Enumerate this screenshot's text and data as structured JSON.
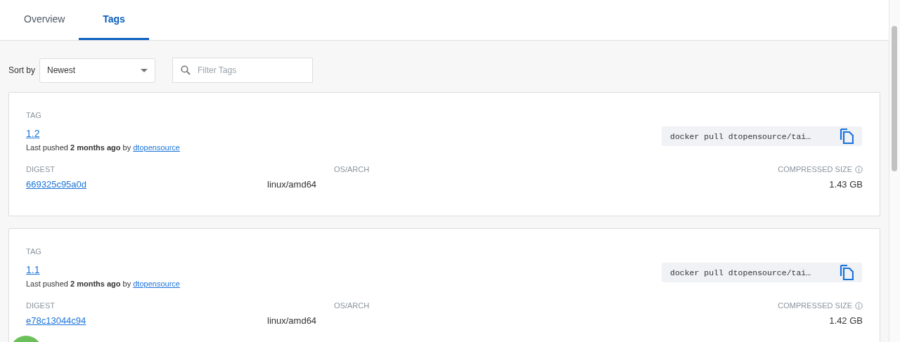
{
  "tabs": [
    {
      "label": "Overview",
      "selected": false
    },
    {
      "label": "Tags",
      "selected": true
    }
  ],
  "toolbar": {
    "sort_label": "Sort by",
    "sort_value": "Newest",
    "filter": {
      "placeholder": "Filter Tags"
    }
  },
  "tags": [
    {
      "tag_label": "TAG",
      "tag": "1.2",
      "pushed": "Last pushed **2 months ago** by",
      "user": "dtopensource",
      "command": "docker pull dtopensource/tai…",
      "digest_label": "DIGEST",
      "digest": "669325c95a0d",
      "os_label": "OS/ARCH",
      "os": "linux/amd64",
      "size_label": "COMPRESSED SIZE",
      "size": "1.43 GB"
    },
    {
      "tag_label": "TAG",
      "tag": "1.1",
      "pushed": "Last pushed **2 months ago** by",
      "user": "dtopensource",
      "command": "docker pull dtopensource/tai…",
      "digest_label": "DIGEST",
      "digest": "e78c13044c94",
      "os_label": "OS/ARCH",
      "os": "linux/amd64",
      "size_label": "COMPRESSED SIZE",
      "size": "1.42 GB"
    }
  ]
}
